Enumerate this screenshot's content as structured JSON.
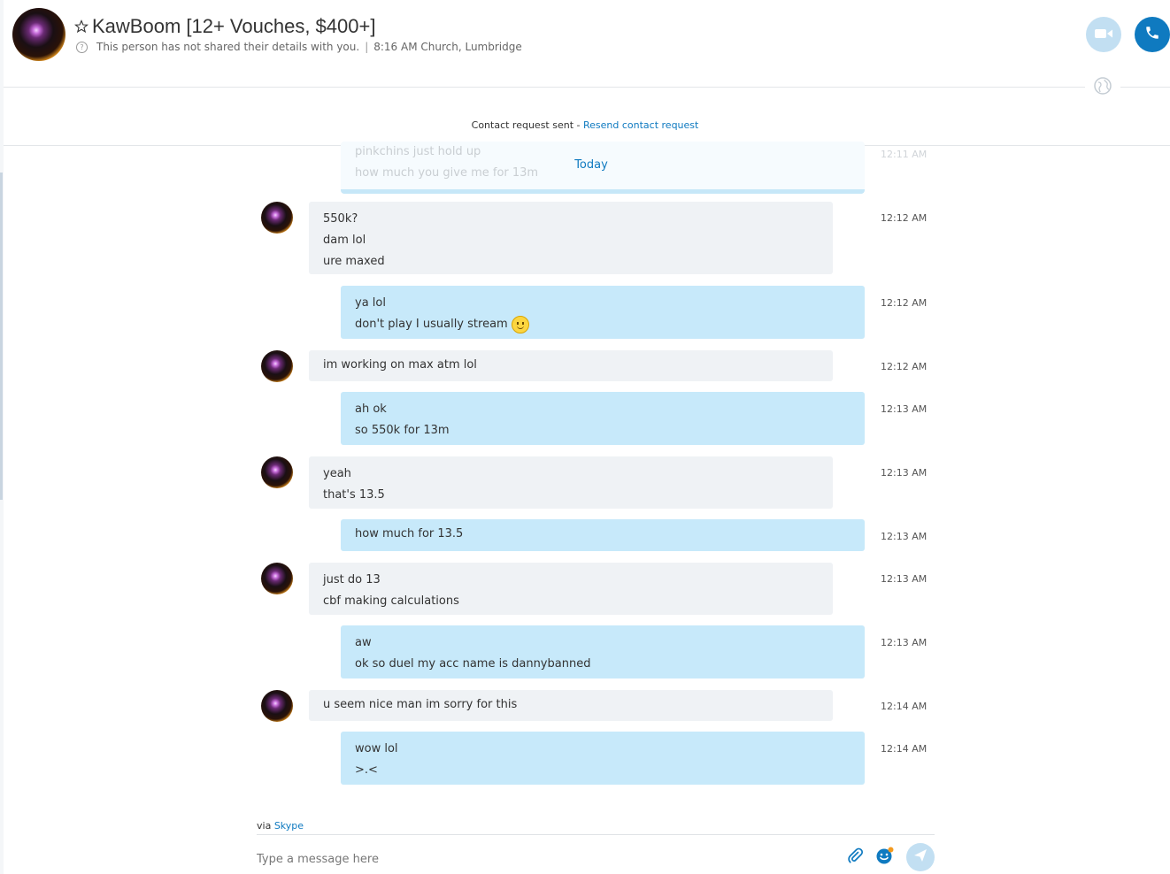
{
  "header": {
    "contact_name": "KawBoom [12+ Vouches, $400+]",
    "privacy_note": "This person has not shared their details with you.",
    "separator": "|",
    "local_info": "8:16 AM Church, Lumbridge",
    "info_icon_glyph": "?"
  },
  "banner": {
    "contact_request_text": "Contact request sent - ",
    "resend_link": "Resend contact request"
  },
  "faded_previous": {
    "lines": [
      "pinkchins just hold up",
      "how much you give me for 13m"
    ],
    "time": "12:11 AM"
  },
  "day_divider": "Today",
  "messages": [
    {
      "direction": "in",
      "lines": [
        "550k?",
        "dam lol",
        "ure maxed"
      ],
      "time": "12:12 AM"
    },
    {
      "direction": "out",
      "lines": [
        "ya lol",
        "don't play I usually stream"
      ],
      "emoji_on_line": 1,
      "time": "12:12 AM"
    },
    {
      "direction": "in",
      "lines": [
        "im working on max atm lol"
      ],
      "time": "12:12 AM"
    },
    {
      "direction": "out",
      "lines": [
        "ah ok",
        "so 550k for 13m"
      ],
      "time": "12:13 AM"
    },
    {
      "direction": "in",
      "lines": [
        "yeah",
        "that's 13.5"
      ],
      "time": "12:13 AM"
    },
    {
      "direction": "out",
      "lines": [
        "how much for 13.5"
      ],
      "time": "12:13 AM"
    },
    {
      "direction": "in",
      "lines": [
        "just do 13",
        "cbf making calculations"
      ],
      "time": "12:13 AM"
    },
    {
      "direction": "out",
      "lines": [
        "aw",
        "ok so duel my acc name is dannybanned"
      ],
      "time": "12:13 AM"
    },
    {
      "direction": "in",
      "lines": [
        "u seem nice man im sorry for this"
      ],
      "time": "12:14 AM"
    },
    {
      "direction": "out",
      "lines": [
        "wow lol",
        ">.<"
      ],
      "time": "12:14 AM"
    }
  ],
  "footer": {
    "via_prefix": "via ",
    "via_link": "Skype",
    "composer_placeholder": "Type a message here"
  },
  "colors": {
    "accent": "#0f7ac0",
    "incoming_bubble": "#eff2f5",
    "outgoing_bubble": "#c7e9fa",
    "light_button": "#c2dff2"
  },
  "icons": {
    "favorite": "star-icon",
    "video_call": "video-camera-icon",
    "audio_call": "phone-icon",
    "globe": "globe-icon",
    "attach": "paperclip-icon",
    "emoticons": "smiley-icon",
    "send": "send-icon"
  }
}
